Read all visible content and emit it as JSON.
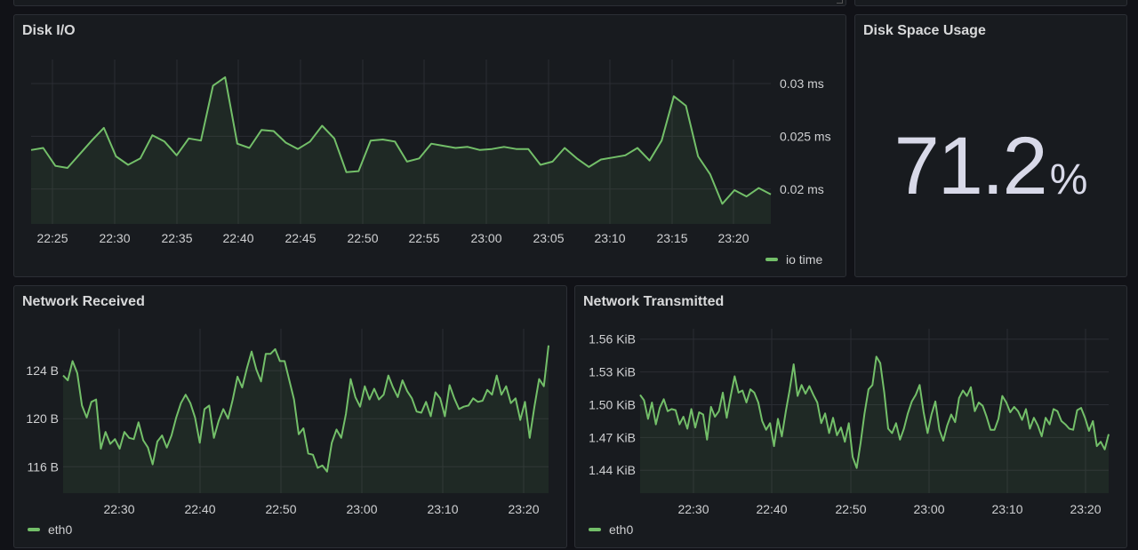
{
  "panels": {
    "disk_io": {
      "title": "Disk I/O",
      "legend": "io time",
      "color": "#73bf69"
    },
    "disk_space": {
      "title": "Disk Space Usage",
      "value": "71.2",
      "unit": "%"
    },
    "net_rx": {
      "title": "Network Received",
      "legend": "eth0",
      "color": "#73bf69"
    },
    "net_tx": {
      "title": "Network Transmitted",
      "legend": "eth0",
      "color": "#73bf69"
    }
  },
  "chart_data": [
    {
      "id": "disk_io",
      "type": "area",
      "title": "Disk I/O",
      "x_start_min": 1343,
      "x_step_min": 1,
      "x_range_min": [
        1343,
        1427
      ],
      "y_unit": "ms",
      "y_axis_side": "right",
      "ylim": [
        0.0167,
        0.0316
      ],
      "y_ticks": [
        0.02,
        0.025,
        0.03
      ],
      "y_tick_labels": [
        "0.02 ms",
        "0.025 ms",
        "0.03 ms"
      ],
      "x_ticks": [
        1345,
        1350,
        1355,
        1360,
        1365,
        1370,
        1375,
        1380,
        1385,
        1390,
        1395,
        1400,
        1405
      ],
      "x_tick_labels": [
        "22:25",
        "22:30",
        "22:35",
        "22:40",
        "22:45",
        "22:50",
        "22:55",
        "23:00",
        "23:05",
        "23:10",
        "23:15",
        "23:20"
      ],
      "series": [
        {
          "name": "io time",
          "values": [
            0.0237,
            0.0239,
            0.0222,
            0.022,
            0.0233,
            0.0246,
            0.0258,
            0.0231,
            0.0223,
            0.0229,
            0.0251,
            0.0245,
            0.0232,
            0.0248,
            0.0246,
            0.0298,
            0.0306,
            0.0243,
            0.0239,
            0.0256,
            0.0255,
            0.0244,
            0.0238,
            0.0245,
            0.026,
            0.0248,
            0.0216,
            0.0217,
            0.0246,
            0.0247,
            0.0245,
            0.0226,
            0.0229,
            0.0243,
            0.0241,
            0.0239,
            0.024,
            0.0237,
            0.0238,
            0.024,
            0.0238,
            0.0238,
            0.0223,
            0.0226,
            0.0239,
            0.0229,
            0.0221,
            0.0228,
            0.023,
            0.0232,
            0.0239,
            0.0227,
            0.0246,
            0.0288,
            0.0279,
            0.0231,
            0.0214,
            0.0186,
            0.0199,
            0.0193,
            0.0201,
            0.0195
          ]
        }
      ]
    },
    {
      "id": "net_rx",
      "type": "area",
      "title": "Network Received",
      "y_unit": "B",
      "ylim": [
        113.8,
        126.9
      ],
      "y_ticks": [
        116,
        120,
        124
      ],
      "y_tick_labels": [
        "116 B",
        "120 B",
        "124 B"
      ],
      "x_tick_labels": [
        "22:30",
        "22:40",
        "22:50",
        "23:00",
        "23:10",
        "23:20"
      ],
      "series": [
        {
          "name": "eth0",
          "values": [
            123.6,
            123.2,
            124.8,
            123.8,
            121.1,
            120.1,
            121.4,
            121.6,
            117.5,
            118.9,
            117.9,
            118.3,
            117.5,
            118.9,
            118.4,
            118.3,
            119.7,
            118.2,
            117.6,
            116.2,
            118.1,
            118.6,
            117.6,
            118.6,
            120.1,
            121.3,
            122.0,
            121.3,
            120.1,
            118.0,
            120.8,
            121.1,
            118.4,
            119.8,
            120.8,
            120.0,
            121.6,
            123.5,
            122.6,
            124.2,
            125.6,
            124.1,
            123.1,
            125.4,
            125.4,
            125.8,
            124.8,
            124.8,
            123.2,
            121.6,
            118.7,
            119.2,
            117.1,
            117.0,
            115.9,
            116.1,
            115.6,
            118.0,
            119.1,
            118.4,
            120.4,
            123.3,
            121.8,
            121.0,
            122.7,
            121.6,
            122.5,
            121.6,
            122.0,
            123.6,
            122.6,
            121.8,
            123.2,
            122.3,
            121.7,
            120.6,
            120.5,
            121.4,
            120.2,
            122.2,
            121.7,
            120.2,
            122.8,
            121.7,
            120.8,
            121.0,
            121.1,
            121.7,
            121.4,
            121.5,
            122.4,
            122.0,
            123.6,
            122.0,
            122.7,
            121.3,
            121.7,
            119.9,
            121.4,
            118.4,
            121.0,
            123.3,
            122.7,
            126.1
          ]
        }
      ]
    },
    {
      "id": "net_tx",
      "type": "area",
      "title": "Network Transmitted",
      "y_unit": "KiB",
      "ylim": [
        1.419,
        1.563
      ],
      "y_ticks": [
        1.44,
        1.47,
        1.5,
        1.53,
        1.56
      ],
      "y_tick_labels": [
        "1.44 KiB",
        "1.47 KiB",
        "1.50 KiB",
        "1.53 KiB",
        "1.56 KiB"
      ],
      "x_tick_labels": [
        "22:30",
        "22:40",
        "22:50",
        "23:00",
        "23:10",
        "23:20"
      ],
      "series": [
        {
          "name": "eth0",
          "values": [
            1.509,
            1.504,
            1.487,
            1.502,
            1.482,
            1.497,
            1.505,
            1.494,
            1.496,
            1.495,
            1.482,
            1.489,
            1.478,
            1.496,
            1.479,
            1.493,
            1.491,
            1.468,
            1.498,
            1.489,
            1.494,
            1.511,
            1.488,
            1.508,
            1.526,
            1.511,
            1.513,
            1.502,
            1.514,
            1.511,
            1.502,
            1.485,
            1.477,
            1.483,
            1.462,
            1.487,
            1.471,
            1.494,
            1.514,
            1.537,
            1.508,
            1.518,
            1.51,
            1.517,
            1.509,
            1.502,
            1.483,
            1.492,
            1.474,
            1.488,
            1.472,
            1.479,
            1.466,
            1.483,
            1.452,
            1.442,
            1.465,
            1.492,
            1.514,
            1.518,
            1.544,
            1.538,
            1.511,
            1.478,
            1.474,
            1.483,
            1.468,
            1.478,
            1.492,
            1.503,
            1.509,
            1.518,
            1.493,
            1.474,
            1.491,
            1.503,
            1.477,
            1.467,
            1.481,
            1.491,
            1.484,
            1.506,
            1.513,
            1.508,
            1.516,
            1.494,
            1.502,
            1.499,
            1.489,
            1.477,
            1.477,
            1.487,
            1.508,
            1.502,
            1.493,
            1.498,
            1.494,
            1.486,
            1.496,
            1.478,
            1.488,
            1.481,
            1.471,
            1.488,
            1.482,
            1.496,
            1.494,
            1.485,
            1.482,
            1.478,
            1.477,
            1.495,
            1.497,
            1.488,
            1.476,
            1.485,
            1.462,
            1.466,
            1.459,
            1.473
          ]
        }
      ]
    }
  ]
}
